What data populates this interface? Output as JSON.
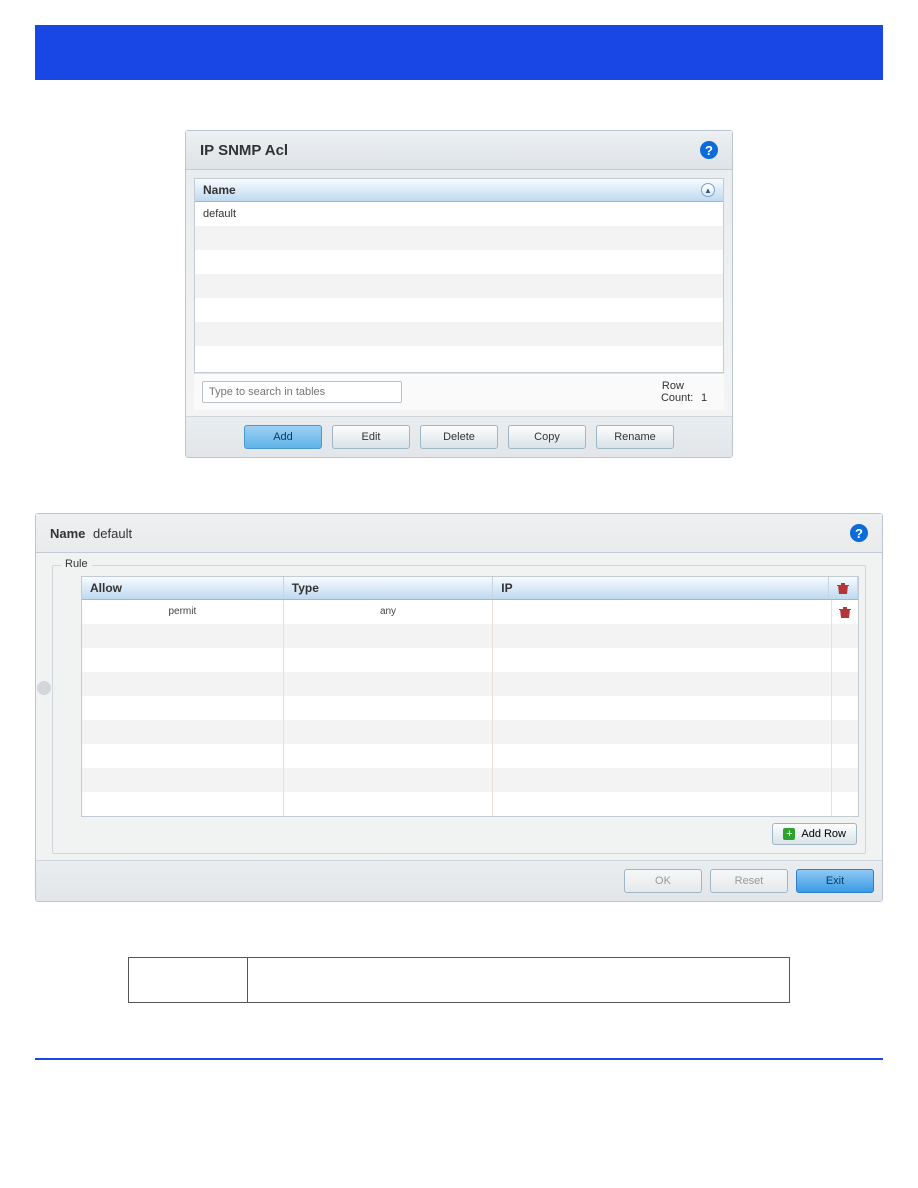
{
  "panel1": {
    "title": "IP SNMP Acl",
    "column_header": "Name",
    "rows": [
      "default"
    ],
    "search_placeholder": "Type to search in tables",
    "rowcount_label": "Row Count:",
    "rowcount_value": "1",
    "buttons": {
      "add": "Add",
      "edit": "Edit",
      "delete": "Delete",
      "copy": "Copy",
      "rename": "Rename"
    }
  },
  "panel2": {
    "name_label": "Name",
    "name_value": "default",
    "group_title": "Rule",
    "headers": {
      "allow": "Allow",
      "type": "Type",
      "ip": "IP"
    },
    "rows": [
      {
        "allow": "permit",
        "type": "any",
        "ip": ""
      }
    ],
    "add_row": "Add Row",
    "buttons": {
      "ok": "OK",
      "reset": "Reset",
      "exit": "Exit"
    }
  }
}
